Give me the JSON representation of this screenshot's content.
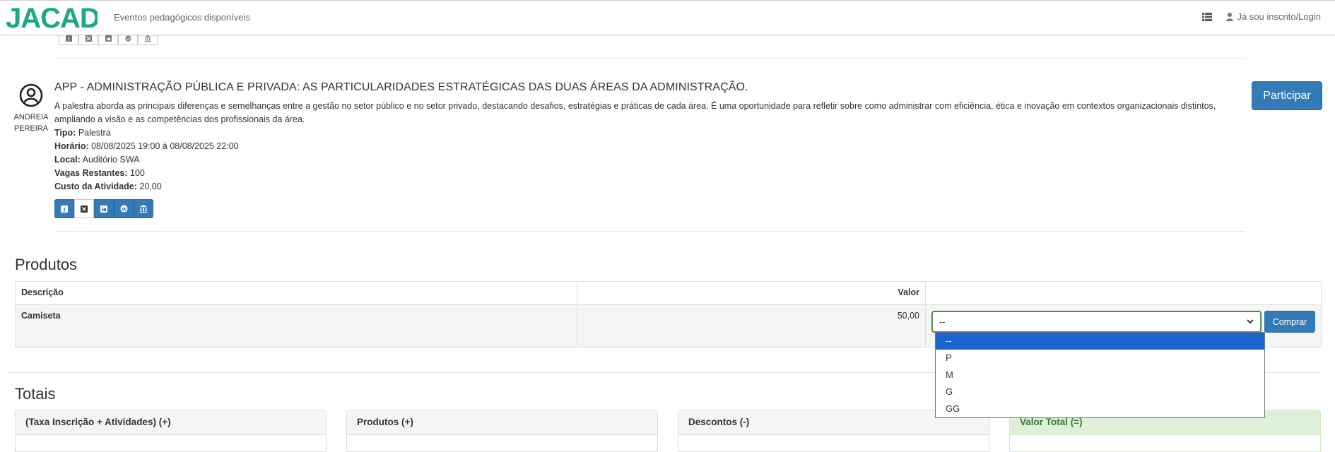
{
  "navbar": {
    "brand": "JACAD",
    "events_link": "Eventos pedagógicos disponíveis",
    "login_link": "Já sou inscrito/Login"
  },
  "event": {
    "speaker_first": "ANDREIA",
    "speaker_last": "PEREIRA",
    "title": "APP - ADMINISTRAÇÃO PÚBLICA E PRIVADA: AS PARTICULARIDADES ESTRATÉGICAS DAS DUAS ÁREAS DA ADMINISTRAÇÃO.",
    "description": "A palestra aborda as principais diferenças e semelhanças entre a gestão no setor público e no setor privado, destacando desafios, estratégias e práticas de cada área. É uma oportunidade para refletir sobre como administrar com eficiência, ética e inovação em contextos organizacionais distintos, ampliando a visão e as competências dos profissionais da área.",
    "tipo_label": "Tipo:",
    "tipo": "Palestra",
    "horario_label": "Horário:",
    "horario": "08/08/2025 19:00 à 08/08/2025 22:00",
    "local_label": "Local:",
    "local": "Auditório SWA",
    "vagas_label": "Vagas Restantes:",
    "vagas": "100",
    "custo_label": "Custo da Atividade:",
    "custo": "20,00",
    "participar_label": "Participar"
  },
  "products": {
    "title": "Produtos",
    "headers": [
      "Descrição",
      "Valor",
      ""
    ],
    "rows": [
      {
        "descricao": "Camiseta",
        "valor": "50,00",
        "selected": "--",
        "buy_label": "Comprar"
      }
    ],
    "size_options": [
      "--",
      "P",
      "M",
      "G",
      "GG"
    ]
  },
  "totals": {
    "title": "Totais",
    "panels": [
      {
        "label": "(Taxa Inscrição + Atividades) (+)"
      },
      {
        "label": "Produtos (+)"
      },
      {
        "label": "Descontos (-)"
      },
      {
        "label": "Valor Total (=)"
      }
    ]
  },
  "colors": {
    "primary": "#337ab7",
    "success_bg": "#dff0d8",
    "success_text": "#3c763d",
    "brand_green": "#1ba883",
    "dropdown_selected": "#1a64d2"
  }
}
